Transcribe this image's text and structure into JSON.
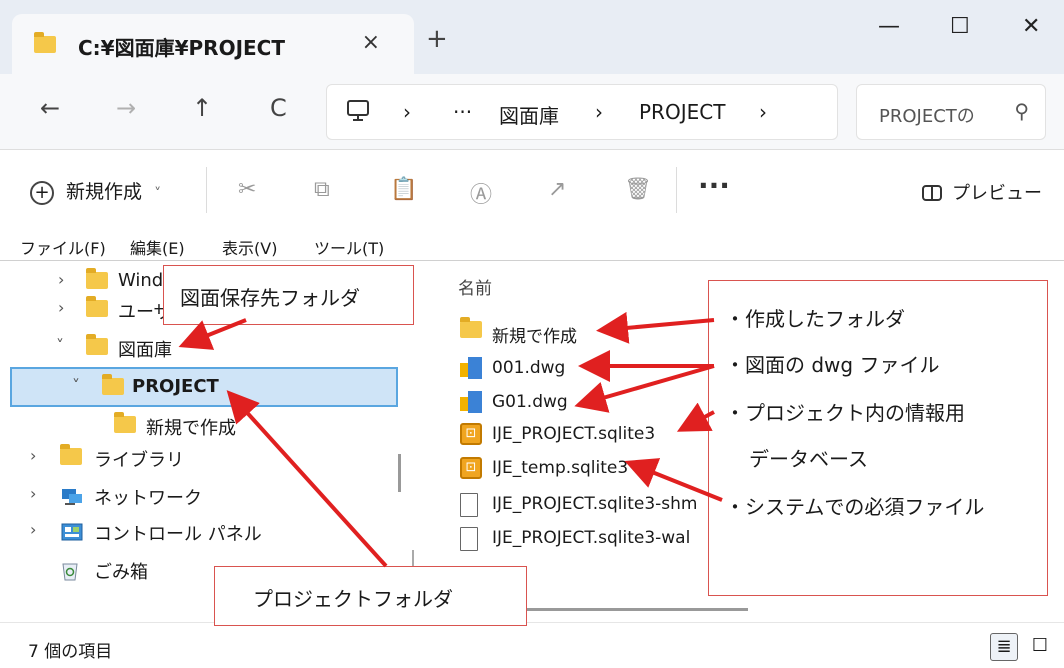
{
  "window": {
    "tab_title": "C:¥図面庫¥PROJECT",
    "tab_close": "×",
    "new_tab": "+",
    "minimize": "—",
    "maximize": "☐",
    "close": "✕"
  },
  "nav": {
    "back": "←",
    "forward": "→",
    "up": "↑",
    "refresh": "C",
    "breadcrumb": [
      "›",
      "···",
      "図面庫",
      "›",
      "PROJECT",
      "›"
    ],
    "search_placeholder": "PROJECTの",
    "search_icon": "⚲"
  },
  "commands": {
    "new_label": "新規作成",
    "new_chevron": "˅",
    "cut": "✂",
    "copy": "⧉",
    "paste": "📋",
    "rename": "Ⓐ",
    "share": "↗",
    "delete": "🗑",
    "more": "···",
    "preview": "プレビュー"
  },
  "menubar": [
    "ファイル(F)",
    "編集(E)",
    "表示(V)",
    "ツール(T)"
  ],
  "tree": [
    {
      "label": "Wind",
      "chevron": "›"
    },
    {
      "label": "ユーザ",
      "chevron": "›"
    },
    {
      "label": "図面庫",
      "chevron": "˅"
    },
    {
      "label": "PROJECT",
      "chevron": "˅"
    },
    {
      "label": "新規で作成",
      "chevron": ""
    },
    {
      "label": "ライブラリ",
      "chevron": "›"
    },
    {
      "label": "ネットワーク",
      "chevron": "›"
    },
    {
      "label": "コントロール パネル",
      "chevron": "›"
    },
    {
      "label": "ごみ箱",
      "chevron": ""
    }
  ],
  "files": {
    "column_name": "名前",
    "items": [
      {
        "name": "新規で作成",
        "icon": "folder-icon"
      },
      {
        "name": "001.dwg",
        "icon": "dwg-icon"
      },
      {
        "name": "G01.dwg",
        "icon": "dwg-icon"
      },
      {
        "name": "IJE_PROJECT.sqlite3",
        "icon": "lock-icon"
      },
      {
        "name": "IJE_temp.sqlite3",
        "icon": "lock-icon"
      },
      {
        "name": "IJE_PROJECT.sqlite3-shm",
        "icon": "document-icon"
      },
      {
        "name": "IJE_PROJECT.sqlite3-wal",
        "icon": "document-icon"
      }
    ]
  },
  "status": {
    "item_count": "7 個の項目",
    "details_view": "≣",
    "tiles_view": "☐"
  },
  "annotations": {
    "drawing_folder": "図面保存先フォルダ",
    "project_folder": "プロジェクトフォルダ",
    "notes": [
      "・作成したフォルダ",
      "・図面の dwg ファイル",
      "・プロジェクト内の情報用",
      "データベース",
      "・システムでの必須ファイル"
    ],
    "arrow_color": "#e02020",
    "border_color": "#d9534f"
  }
}
